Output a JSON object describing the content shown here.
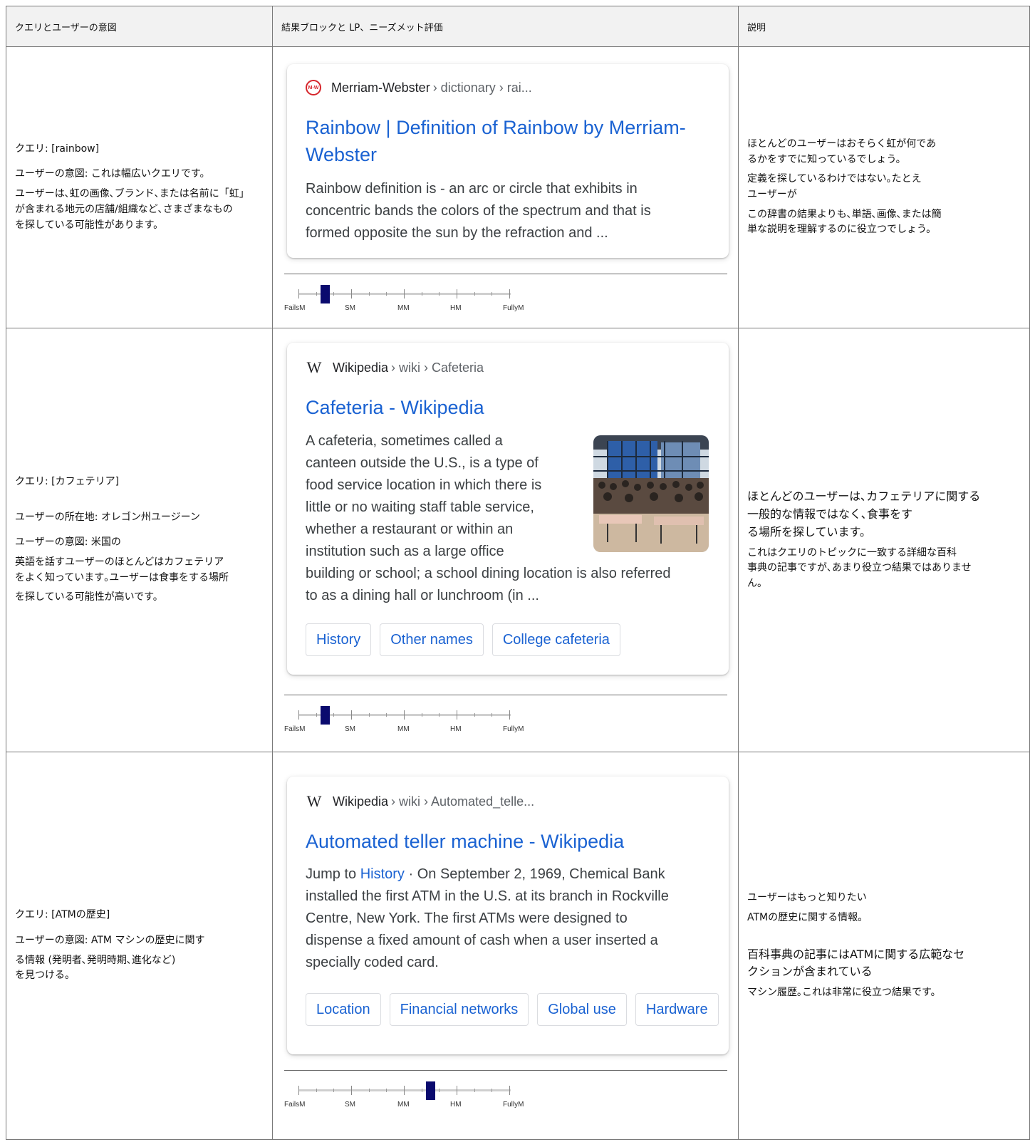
{
  "headers": {
    "col1": "クエリとユーザーの意図",
    "col2": "結果ブロックと LP、ニーズメット評価",
    "col3": "説明"
  },
  "rating_labels": [
    "FailsM",
    "SM",
    "MM",
    "HM",
    "FullyM"
  ],
  "rows": [
    {
      "query": "クエリ: [rainbow]",
      "intent_lines": [
        "ユーザーの意図: これは幅広いクエリです。",
        "ユーザーは､虹の画像､ブランド､または名前に「虹」",
        "が含まれる地元の店舗/組織など､さまざまなもの",
        "を探している可能性があります。"
      ],
      "result": {
        "logo": "M-W",
        "logo_icon": "merriam-webster-logo-icon",
        "site": "Merriam-Webster",
        "path": "› dictionary › rai...",
        "title_lines": [
          "Rainbow | Definition of Rainbow by Merriam-",
          "Webster"
        ],
        "snippet_lines": [
          "Rainbow definition is - an arc or circle that exhibits in",
          "concentric bands the colors of the spectrum and that is",
          "formed opposite the sun by the refraction and ..."
        ]
      },
      "rating": "SM",
      "explanation_lines": [
        "ほとんどのユーザーはおそらく虹が何であ",
        "るかをすでに知っているでしょう。",
        "定義を探しているわけではない｡たとえ",
        "ユーザーが",
        "この辞書の結果よりも､単語､画像､または簡",
        "単な説明を理解するのに役立つでしょう。"
      ]
    },
    {
      "query": "クエリ: [カフェテリア]",
      "location": "ユーザーの所在地: オレゴン州ユージーン",
      "intent_lines": [
        "ユーザーの意図: 米国の",
        "英語を話すユーザーのほとんどはカフェテリア",
        "をよく知っています｡ユーザーは食事をする場所",
        "を探している可能性が高いです。"
      ],
      "result": {
        "logo": "W",
        "logo_icon": "wikipedia-logo-icon",
        "site": "Wikipedia",
        "path": "› wiki › Cafeteria",
        "title_lines": [
          "Cafeteria - Wikipedia"
        ],
        "snippet_lines": [
          "A cafeteria, sometimes called a",
          "canteen outside the U.S., is a type of",
          "food service location in which there is",
          "little or no waiting staff table service,",
          "whether a restaurant or within an",
          "institution such as a large office",
          "building or school; a school dining location is also referred",
          "to as a dining hall or lunchroom (in ..."
        ],
        "chips": [
          "History",
          "Other names",
          "College cafeteria"
        ]
      },
      "rating": "SM",
      "explanation_lines": [
        "ほとんどのユーザーは､カフェテリアに関する",
        "一般的な情報ではなく､食事をす",
        "る場所を探しています。",
        "これはクエリのトピックに一致する詳細な百科",
        "事典の記事ですが､あまり役立つ結果ではありませ",
        "ん。"
      ]
    },
    {
      "query": "クエリ: [ATMの歴史]",
      "intent_lines": [
        "ユーザーの意図: ATM マシンの歴史に関す",
        "る情報 (発明者､発明時期､進化など)",
        "を見つける。"
      ],
      "result": {
        "logo": "W",
        "logo_icon": "wikipedia-logo-icon",
        "site": "Wikipedia",
        "path": "› wiki › Automated_telle...",
        "title_lines": [
          "Automated teller machine - Wikipedia"
        ],
        "snippet_first_prefix": "Jump to ",
        "snippet_first_link": "History",
        "snippet_first_rest": " · On September 2, 1969, Chemical Bank",
        "snippet_lines": [
          "installed the first ATM in the U.S. at its branch in Rockville",
          "Centre, New York. The first ATMs were designed to",
          "dispense a fixed amount of cash when a user inserted a",
          "specially coded card."
        ],
        "chips": [
          "Location",
          "Financial networks",
          "Global use",
          "Hardware"
        ]
      },
      "rating": "HM",
      "explanation_lines": [
        "ユーザーはもっと知りたい",
        "ATMの歴史に関する情報。",
        "百科事典の記事にはATMに関する広範なセ",
        "クションが含まれている",
        "マシン履歴｡これは非常に役立つ結果です。"
      ]
    }
  ],
  "colors": {
    "link": "#1a62d2",
    "marker": "#0a0a6e",
    "border": "#7a7a7a",
    "header_bg": "#f2f2f2"
  }
}
